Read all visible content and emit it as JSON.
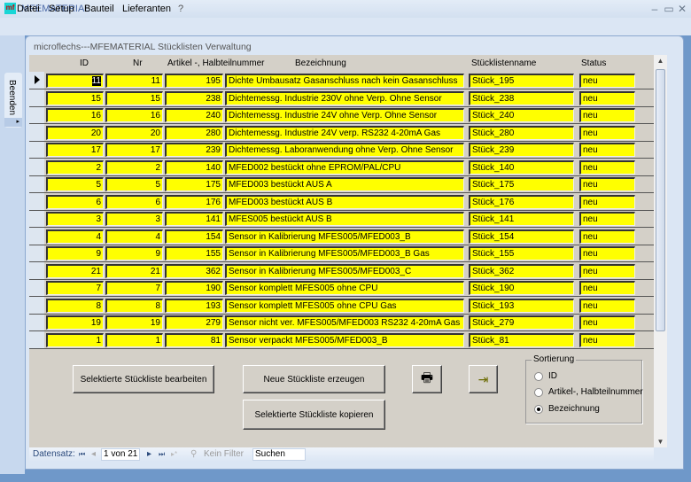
{
  "window": {
    "title": "MFEMATERIAL",
    "icon_text": "mf",
    "minimize": "–",
    "maximize": "▭",
    "close": "✕"
  },
  "menu": [
    {
      "label": "Datei"
    },
    {
      "label": "Setup"
    },
    {
      "label": "Bauteil"
    },
    {
      "label": "Lieferanten"
    },
    {
      "label": "?"
    }
  ],
  "sidebar": {
    "beenden_label": "Beenden",
    "expand": "▸"
  },
  "form": {
    "title": "microflechs---MFEMATERIAL Stücklisten Verwaltung"
  },
  "grid": {
    "headers": [
      "ID",
      "Nr",
      "Artikel -, Halbteilnummer",
      "Bezeichnung",
      "Stücklistenname",
      "Status"
    ],
    "rows": [
      [
        "11",
        "11",
        "195",
        "Dichte Umbausatz Gasanschluss nach kein Gasanschluss",
        "Stück_195",
        "neu"
      ],
      [
        "15",
        "15",
        "238",
        "Dichtemessg. Industrie 230V ohne Verp. Ohne Sensor",
        "Stück_238",
        "neu"
      ],
      [
        "16",
        "16",
        "240",
        "Dichtemessg. Industrie 24V ohne Verp. Ohne Sensor",
        "Stück_240",
        "neu"
      ],
      [
        "20",
        "20",
        "280",
        "Dichtemessg. Industrie 24V verp. RS232 4-20mA Gas",
        "Stück_280",
        "neu"
      ],
      [
        "17",
        "17",
        "239",
        "Dichtemessg. Laboranwendung ohne Verp. Ohne Sensor",
        "Stück_239",
        "neu"
      ],
      [
        "2",
        "2",
        "140",
        "MFED002 bestückt ohne EPROM/PAL/CPU",
        "Stück_140",
        "neu"
      ],
      [
        "5",
        "5",
        "175",
        "MFED003 bestückt AUS A",
        "Stück_175",
        "neu"
      ],
      [
        "6",
        "6",
        "176",
        "MFED003 bestückt AUS B",
        "Stück_176",
        "neu"
      ],
      [
        "3",
        "3",
        "141",
        "MFES005 bestückt AUS B",
        "Stück_141",
        "neu"
      ],
      [
        "4",
        "4",
        "154",
        "Sensor in Kalibrierung MFES005/MFED003_B",
        "Stück_154",
        "neu"
      ],
      [
        "9",
        "9",
        "155",
        "Sensor in Kalibrierung MFES005/MFED003_B Gas",
        "Stück_155",
        "neu"
      ],
      [
        "21",
        "21",
        "362",
        "Sensor in Kalibrierung MFES005/MFED003_C",
        "Stück_362",
        "neu"
      ],
      [
        "7",
        "7",
        "190",
        "Sensor komplett MFES005 ohne CPU",
        "Stück_190",
        "neu"
      ],
      [
        "8",
        "8",
        "193",
        "Sensor komplett MFES005 ohne CPU Gas",
        "Stück_193",
        "neu"
      ],
      [
        "19",
        "19",
        "279",
        "Sensor nicht ver. MFES005/MFED003 RS232 4-20mA Gas",
        "Stück_279",
        "neu"
      ],
      [
        "1",
        "1",
        "81",
        "Sensor verpackt MFES005/MFED003_B",
        "Stück_81",
        "neu"
      ]
    ],
    "selected_row": 0,
    "cell_color": "#ffff00"
  },
  "buttons": {
    "edit": "Selektierte Stückliste bearbeiten",
    "new": "Neue Stückliste erzeugen",
    "copy": "Selektierte Stückliste kopieren",
    "print_icon": "🖶",
    "exit_icon": "⇥"
  },
  "sort": {
    "legend": "Sortierung",
    "options": [
      "ID",
      "Artikel-, Halbteilnummer",
      "Bezeichnung"
    ],
    "selected": 2
  },
  "nav": {
    "label": "Datensatz:",
    "first": "⏮",
    "prev": "◂",
    "position": "1 von 21",
    "next": "▸",
    "last": "⏭",
    "new": "▸*",
    "filter": "Kein Filter",
    "search": "Suchen"
  }
}
